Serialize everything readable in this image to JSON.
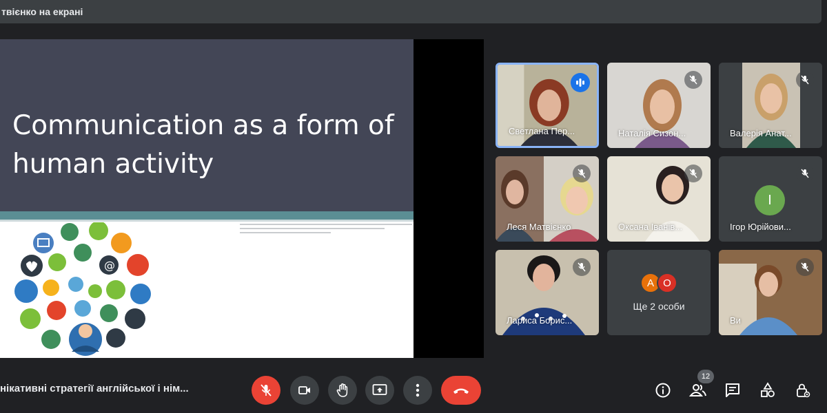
{
  "presenting_banner": "твієнко на екрані",
  "slide": {
    "title": "Communication as a form of human activity"
  },
  "participants": [
    {
      "name": "Светлана Пер...",
      "speaking": true
    },
    {
      "name": "Наталія Сизон...",
      "muted": true
    },
    {
      "name": "Валерія Анат...",
      "muted": true
    },
    {
      "name": "Леся Матвієнко",
      "muted": true
    },
    {
      "name": "Оксана Іванів...",
      "muted": true
    },
    {
      "name": "Ігор Юрійови...",
      "muted": true,
      "avatar_letter": "І"
    },
    {
      "name": "Лариса Борис...",
      "muted": true
    },
    {
      "name": "Ви",
      "muted": true
    }
  ],
  "more_tile": {
    "avatars": [
      "А",
      "О"
    ],
    "label": "Ще 2 особи"
  },
  "meeting_title": "нікативні стратегії англійської і нім...",
  "participant_count": "12",
  "colors": {
    "accent_blue": "#1a73e8",
    "end_call_red": "#ea4335",
    "tile_bg": "#3c4043",
    "app_bg": "#202124"
  },
  "controls": {
    "mic": "mic-off-icon",
    "camera": "camera-icon",
    "raise_hand": "raise-hand-icon",
    "present": "present-screen-icon",
    "more": "more-options-icon",
    "end_call": "end-call-icon",
    "info": "info-icon",
    "people": "people-icon",
    "chat": "chat-icon",
    "activities": "activities-icon",
    "host_controls": "host-lock-icon"
  }
}
